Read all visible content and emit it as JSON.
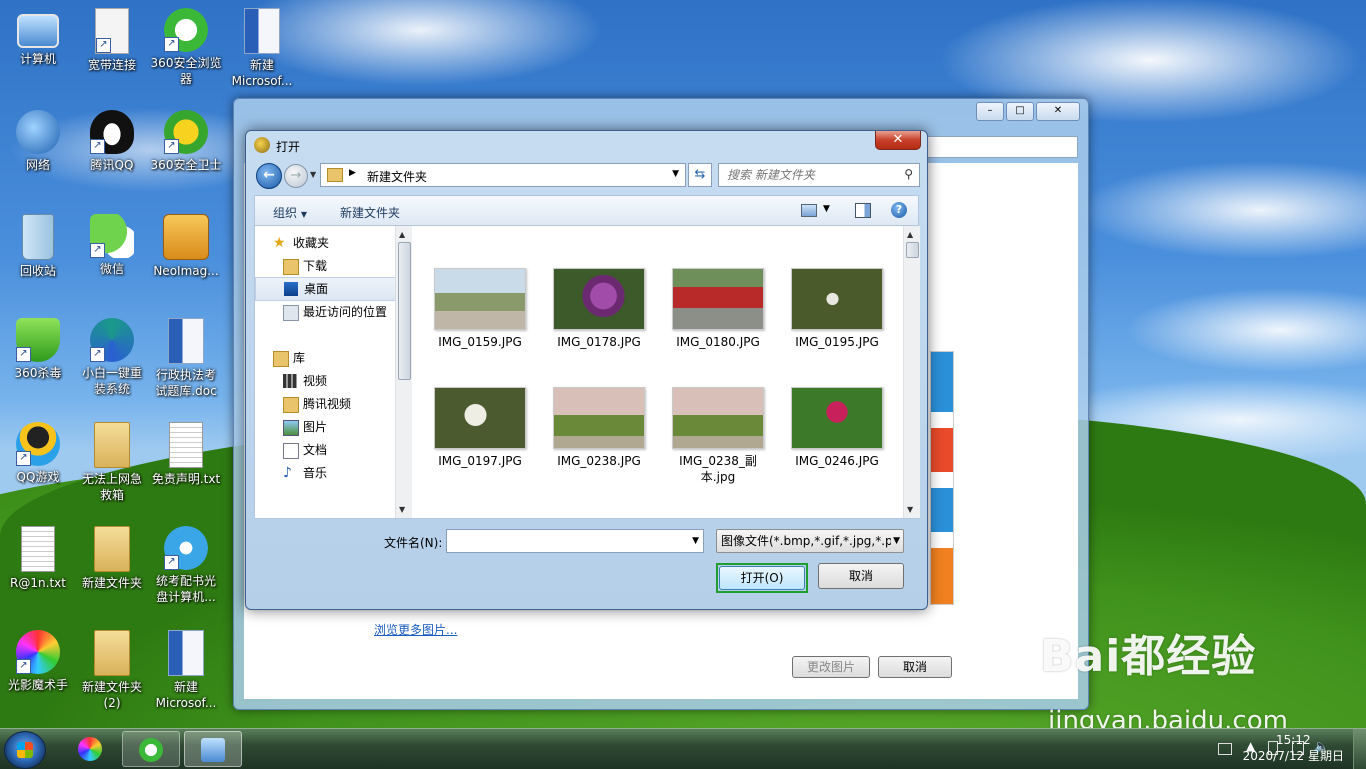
{
  "desktop": {
    "icons": [
      {
        "label": "计算机"
      },
      {
        "label": "宽带连接"
      },
      {
        "label": "360安全浏览\n器"
      },
      {
        "label": "新建\nMicrosof..."
      },
      {
        "label": "网络"
      },
      {
        "label": "腾讯QQ"
      },
      {
        "label": "360安全卫士"
      },
      {
        "label": "回收站"
      },
      {
        "label": "微信"
      },
      {
        "label": "NeoImag..."
      },
      {
        "label": "360杀毒"
      },
      {
        "label": "小白一键重\n装系统"
      },
      {
        "label": "行政执法考\n试题库.doc"
      },
      {
        "label": "QQ游戏"
      },
      {
        "label": "无法上网急\n救箱"
      },
      {
        "label": "免责声明.txt"
      },
      {
        "label": "R@1n.txt"
      },
      {
        "label": "新建文件夹"
      },
      {
        "label": "统考配书光\n盘计算机..."
      },
      {
        "label": "光影魔术手"
      },
      {
        "label": "新建文件夹\n(2)"
      },
      {
        "label": "新建\nMicrosof..."
      }
    ]
  },
  "background_window": {
    "browse_link": "浏览更多图片...",
    "edit_button": "更改图片",
    "cancel_button": "取消"
  },
  "dialog": {
    "title": "打开",
    "close": "✕",
    "address_path": "新建文件夹",
    "search_placeholder": "搜索 新建文件夹",
    "toolbar": {
      "organize": "组织",
      "new_folder": "新建文件夹"
    },
    "nav": {
      "favorites": "收藏夹",
      "downloads": "下载",
      "desktop": "桌面",
      "recent": "最近访问的位置",
      "libraries": "库",
      "videos": "视频",
      "tencent_video": "腾讯视频",
      "pictures": "图片",
      "documents": "文档",
      "music": "音乐"
    },
    "files": [
      {
        "name": "IMG_0159.JPG"
      },
      {
        "name": "IMG_0178.JPG"
      },
      {
        "name": "IMG_0180.JPG"
      },
      {
        "name": "IMG_0195.JPG"
      },
      {
        "name": "IMG_0197.JPG"
      },
      {
        "name": "IMG_0238.JPG"
      },
      {
        "name": "IMG_0238_副本.jpg"
      },
      {
        "name": "IMG_0246.JPG"
      }
    ],
    "filename_label": "文件名(N):",
    "filename_value": "",
    "filter_value": "图像文件(*.bmp,*.gif,*.jpg,*.pi",
    "open_button": "打开(O)",
    "cancel_button": "取消"
  },
  "watermark": {
    "brand": "Bai都经验",
    "url": "jingyan.baidu.com"
  },
  "taskbar": {
    "time": "15:12",
    "date": "2020/7/12 星期日"
  },
  "colors": {
    "highlight_green": "#1f9f30",
    "dialog_frame": "#b5cfe9",
    "link": "#1b5cc1"
  }
}
